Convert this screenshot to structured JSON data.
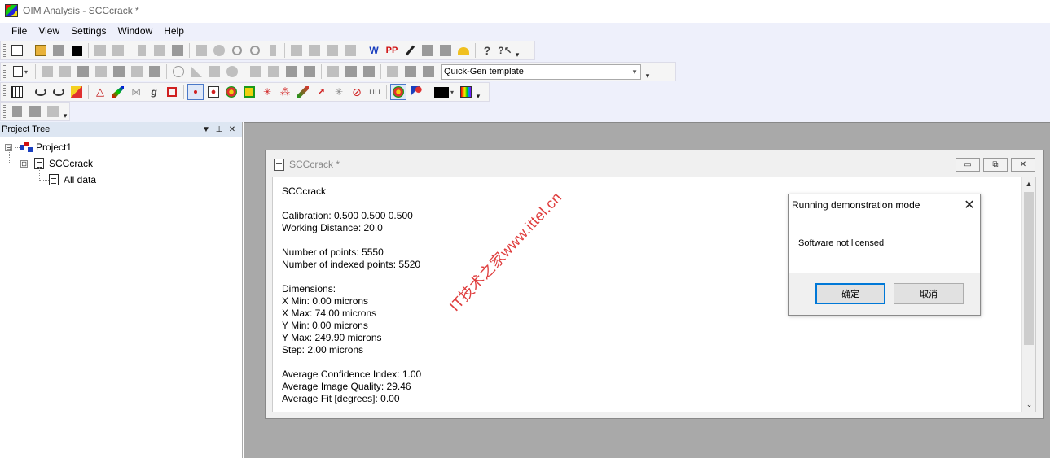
{
  "app": {
    "title": "OIM Analysis - SCCcrack *"
  },
  "menu": [
    "File",
    "View",
    "Settings",
    "Window",
    "Help"
  ],
  "toolbar": {
    "template_combo_value": "Quick-Gen template",
    "icon_glyphs": {
      "select": "⊙",
      "question": "?",
      "help_pointer": "?↖",
      "w_label": "W",
      "pp_label": "PP",
      "grain_g": "g",
      "arrow_glyph": "↗",
      "star_glyph": "✳",
      "ruler_glyph": "⊔⊔"
    },
    "colors": {
      "accent": "#4a78c8",
      "red_icon": "#d01010",
      "blue_icon": "#1a3fbf"
    }
  },
  "tree": {
    "header": "Project Tree",
    "header_buttons": {
      "dropdown": "▼",
      "pin": "⊥",
      "close": "✕"
    },
    "expander_symbol": "⊟",
    "items": [
      {
        "label": "Project1"
      },
      {
        "label": "SCCcrack"
      },
      {
        "label": "All data"
      }
    ]
  },
  "child_window": {
    "title": "SCCcrack *",
    "buttons": {
      "minimize": "▭",
      "restore": "⧉",
      "close": "✕"
    },
    "content": {
      "name": "SCCcrack",
      "calibration": "Calibration: 0.500  0.500  0.500",
      "working_distance": "Working Distance: 20.0",
      "num_points": "Number of points: 5550",
      "num_indexed": "Number of indexed points: 5520",
      "dimensions_header": "Dimensions:",
      "x_min": "X Min: 0.00 microns",
      "x_max": "X Max: 74.00 microns",
      "y_min": "Y Min: 0.00 microns",
      "y_max": "Y Max: 249.90 microns",
      "step": "Step: 2.00 microns",
      "avg_ci": "Average Confidence Index: 1.00",
      "avg_iq": "Average Image Quality: 29.46",
      "avg_fit": "Average Fit [degrees]: 0.00"
    },
    "scroll": {
      "up": "▲",
      "down": "⌄"
    }
  },
  "dialog": {
    "title": "Running demonstration mode",
    "close": "✕",
    "message": "Software not licensed",
    "ok_label": "确定",
    "cancel_label": "取消"
  },
  "watermark": "IT技术之家www.ittel.cn"
}
